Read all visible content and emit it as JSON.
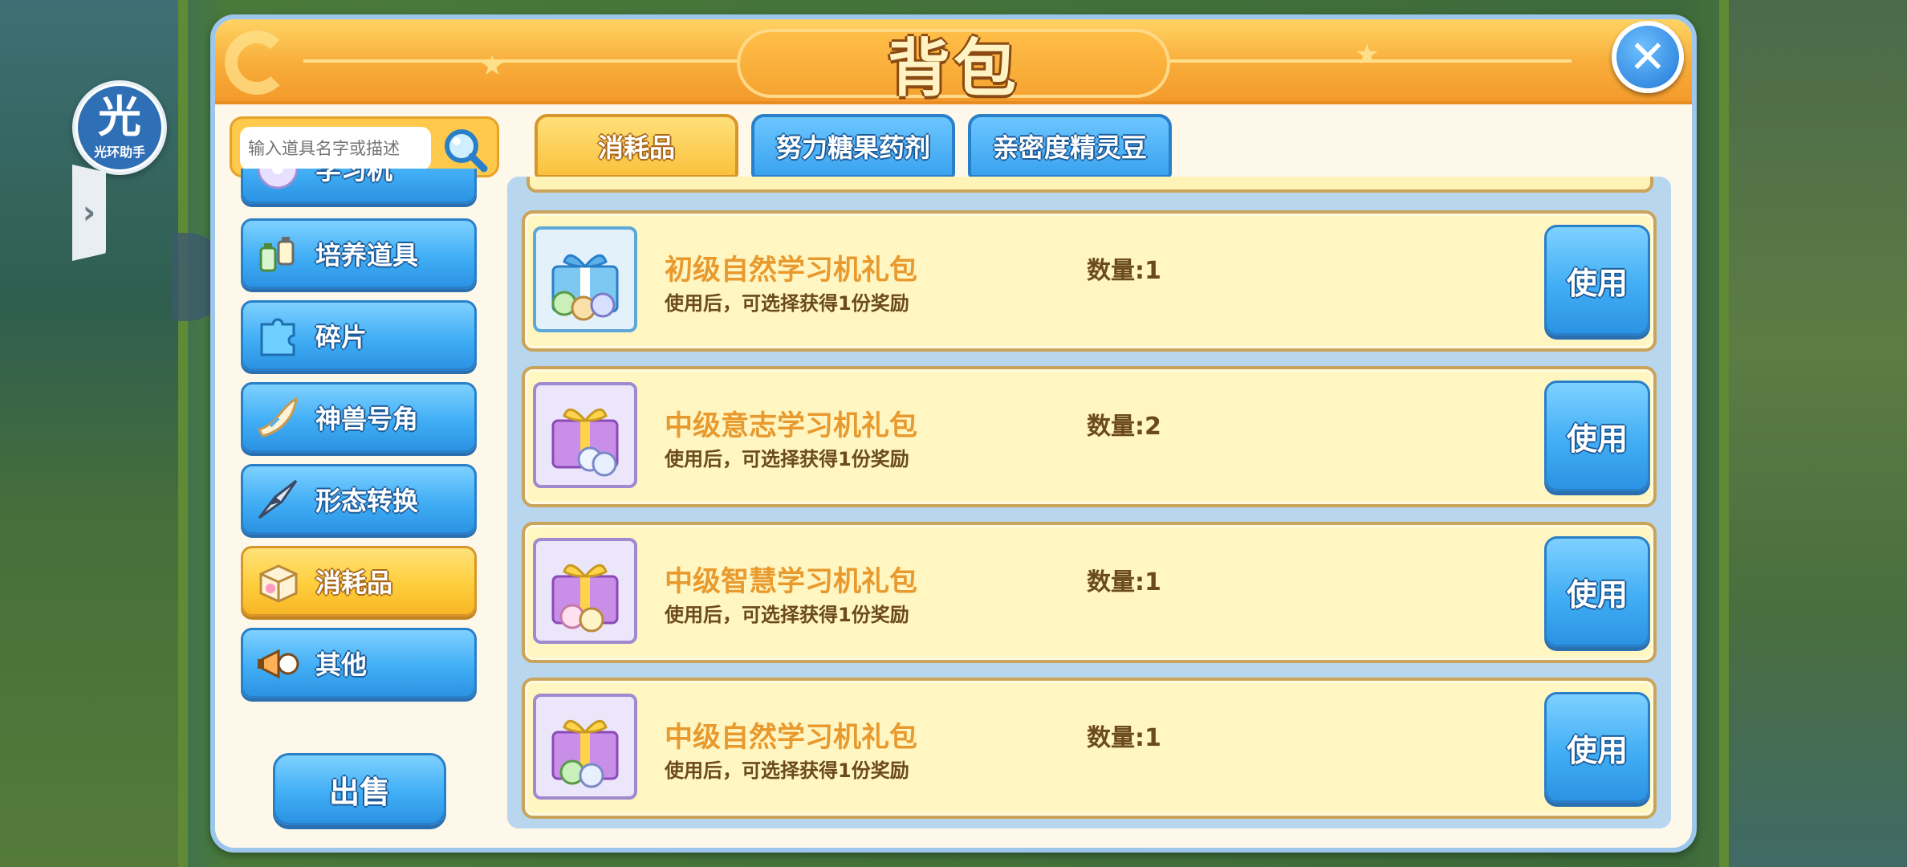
{
  "helper": {
    "glyph": "光",
    "label": "光环助手"
  },
  "window": {
    "title": "背包",
    "close_label": "✕"
  },
  "search": {
    "placeholder": "输入道具名字或描述"
  },
  "categories": [
    {
      "label": "学习机",
      "icon": "disc-icon"
    },
    {
      "label": "培养道具",
      "icon": "potion-icon"
    },
    {
      "label": "碎片",
      "icon": "puzzle-icon"
    },
    {
      "label": "神兽号角",
      "icon": "horn-icon"
    },
    {
      "label": "形态转换",
      "icon": "arrowhead-icon"
    },
    {
      "label": "消耗品",
      "icon": "box-icon",
      "active": true
    },
    {
      "label": "其他",
      "icon": "megaphone-icon"
    }
  ],
  "sell_label": "出售",
  "tabs": [
    {
      "label": "消耗品",
      "active": true
    },
    {
      "label": "努力糖果药剂",
      "active": false
    },
    {
      "label": "亲密度精灵豆",
      "active": false
    }
  ],
  "items": [
    {
      "name": "初级自然学习机礼包",
      "desc": "使用后，可选择获得1份奖励",
      "qty": "数量:1",
      "use_label": "使用",
      "icon": "gift-box-blue-icon"
    },
    {
      "name": "中级意志学习机礼包",
      "desc": "使用后，可选择获得1份奖励",
      "qty": "数量:2",
      "use_label": "使用",
      "icon": "gift-box-purple-icon"
    },
    {
      "name": "中级智慧学习机礼包",
      "desc": "使用后，可选择获得1份奖励",
      "qty": "数量:1",
      "use_label": "使用",
      "icon": "gift-box-purple-icon"
    },
    {
      "name": "中级自然学习机礼包",
      "desc": "使用后，可选择获得1份奖励",
      "qty": "数量:1",
      "use_label": "使用",
      "icon": "gift-box-purple-icon"
    }
  ],
  "colors": {
    "header_orange": "#f8ac3a",
    "button_blue": "#41aef5",
    "active_yellow": "#ffce3c",
    "item_name": "#e89a2e",
    "item_text": "#6b4a1f"
  }
}
